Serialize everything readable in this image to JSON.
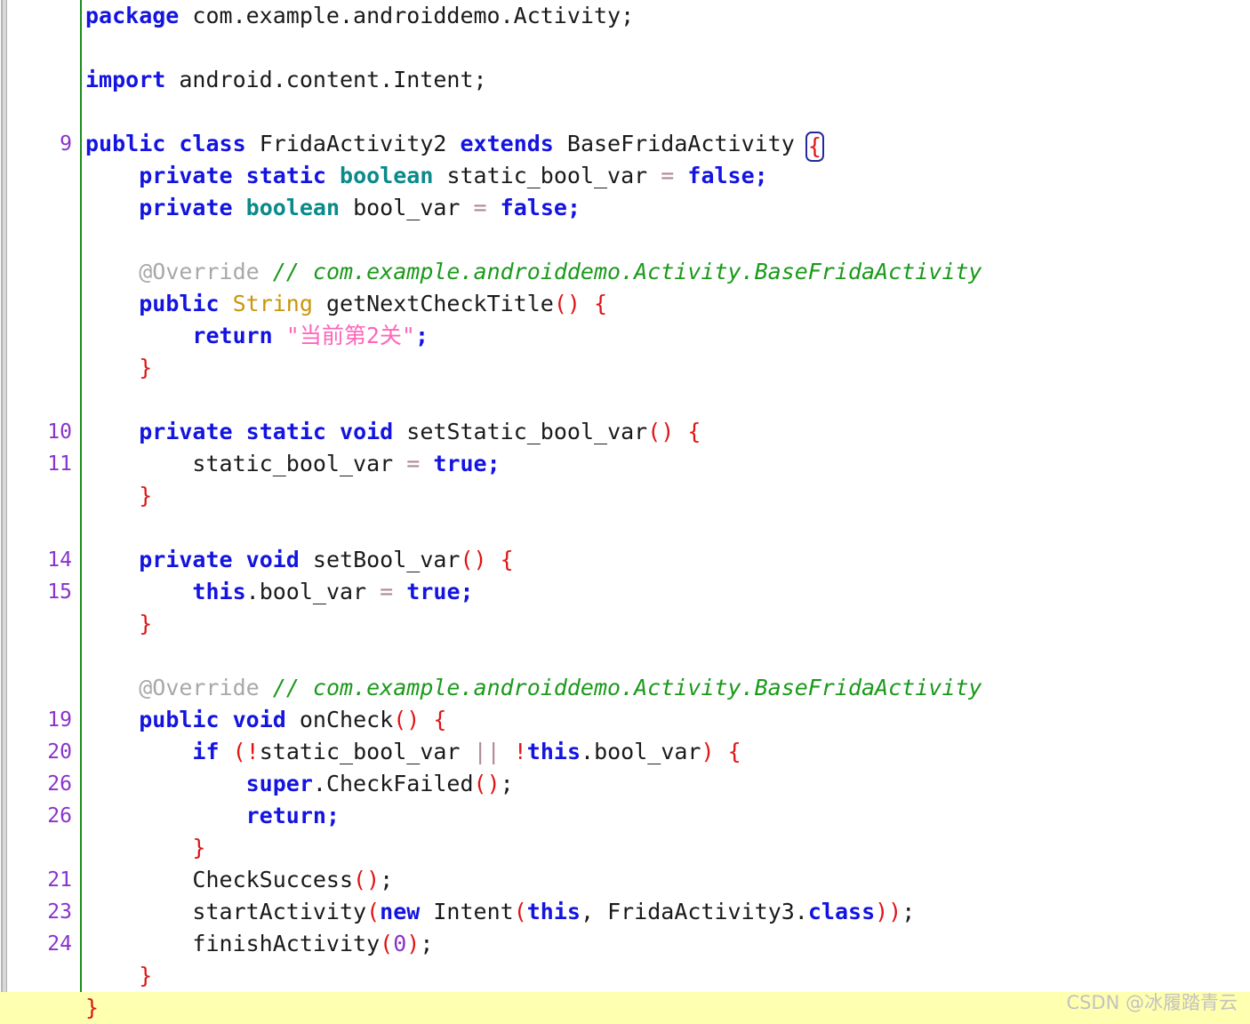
{
  "editor": {
    "language": "java",
    "background_color": "#ffffff",
    "gutter_rule_color": "#1a8c1a",
    "current_line_highlight_color": "#ffffb0",
    "line_number_color": "#8833cc"
  },
  "watermark": {
    "text": "CSDN @冰履踏青云"
  },
  "palette": {
    "keyword": "#1414e0",
    "type": "#0a8a8a",
    "class_type": "#c8960a",
    "identifier": "#1a1a1a",
    "punctuation": "#e01414",
    "number": "#8833cc",
    "string": "#ff66bb",
    "comment": "#1a9a1a",
    "annotation": "#a8a8a8",
    "operator": "#b08898",
    "bracket_match_outline": "#28289c"
  },
  "lines": [
    {
      "lineno": "",
      "current": false,
      "tokens": [
        {
          "t": "package",
          "c": "kw"
        },
        {
          "t": " ",
          "c": "plain"
        },
        {
          "t": "com.example.androiddemo.Activity",
          "c": "plain"
        },
        {
          "t": ";",
          "c": "plain"
        }
      ]
    },
    {
      "lineno": "",
      "current": false,
      "tokens": []
    },
    {
      "lineno": "",
      "current": false,
      "tokens": [
        {
          "t": "import",
          "c": "kw"
        },
        {
          "t": " ",
          "c": "plain"
        },
        {
          "t": "android.content.Intent",
          "c": "plain"
        },
        {
          "t": ";",
          "c": "plain"
        }
      ]
    },
    {
      "lineno": "",
      "current": false,
      "tokens": []
    },
    {
      "lineno": "9",
      "current": false,
      "tokens": [
        {
          "t": "public",
          "c": "kw"
        },
        {
          "t": " ",
          "c": "plain"
        },
        {
          "t": "class",
          "c": "kw"
        },
        {
          "t": " ",
          "c": "plain"
        },
        {
          "t": "FridaActivity2",
          "c": "plain"
        },
        {
          "t": " ",
          "c": "plain"
        },
        {
          "t": "extends",
          "c": "kw"
        },
        {
          "t": " ",
          "c": "plain"
        },
        {
          "t": "BaseFridaActivity",
          "c": "plain"
        },
        {
          "t": " ",
          "c": "plain"
        },
        {
          "t": "{",
          "c": "brace-match"
        }
      ]
    },
    {
      "lineno": "",
      "current": false,
      "tokens": [
        {
          "t": "    ",
          "c": "plain"
        },
        {
          "t": "private",
          "c": "kw"
        },
        {
          "t": " ",
          "c": "plain"
        },
        {
          "t": "static",
          "c": "kw"
        },
        {
          "t": " ",
          "c": "plain"
        },
        {
          "t": "boolean",
          "c": "type"
        },
        {
          "t": " ",
          "c": "plain"
        },
        {
          "t": "static_bool_var",
          "c": "plain"
        },
        {
          "t": " ",
          "c": "plain"
        },
        {
          "t": "=",
          "c": "op"
        },
        {
          "t": " ",
          "c": "plain"
        },
        {
          "t": "false",
          "c": "kw"
        },
        {
          "t": ";",
          "c": "semi"
        }
      ]
    },
    {
      "lineno": "",
      "current": false,
      "tokens": [
        {
          "t": "    ",
          "c": "plain"
        },
        {
          "t": "private",
          "c": "kw"
        },
        {
          "t": " ",
          "c": "plain"
        },
        {
          "t": "boolean",
          "c": "type"
        },
        {
          "t": " ",
          "c": "plain"
        },
        {
          "t": "bool_var",
          "c": "plain"
        },
        {
          "t": " ",
          "c": "plain"
        },
        {
          "t": "=",
          "c": "op"
        },
        {
          "t": " ",
          "c": "plain"
        },
        {
          "t": "false",
          "c": "kw"
        },
        {
          "t": ";",
          "c": "semi"
        }
      ]
    },
    {
      "lineno": "",
      "current": false,
      "tokens": []
    },
    {
      "lineno": "",
      "current": false,
      "tokens": [
        {
          "t": "    ",
          "c": "plain"
        },
        {
          "t": "@Override",
          "c": "anno"
        },
        {
          "t": " ",
          "c": "plain"
        },
        {
          "t": "// com.example.androiddemo.Activity.BaseFridaActivity",
          "c": "cmt"
        }
      ]
    },
    {
      "lineno": "",
      "current": false,
      "tokens": [
        {
          "t": "    ",
          "c": "plain"
        },
        {
          "t": "public",
          "c": "kw"
        },
        {
          "t": " ",
          "c": "plain"
        },
        {
          "t": "String",
          "c": "cls"
        },
        {
          "t": " ",
          "c": "plain"
        },
        {
          "t": "getNextCheckTitle",
          "c": "plain"
        },
        {
          "t": "()",
          "c": "punct"
        },
        {
          "t": " ",
          "c": "plain"
        },
        {
          "t": "{",
          "c": "punct"
        }
      ]
    },
    {
      "lineno": "",
      "current": false,
      "tokens": [
        {
          "t": "        ",
          "c": "plain"
        },
        {
          "t": "return",
          "c": "kw"
        },
        {
          "t": " ",
          "c": "plain"
        },
        {
          "t": "\"当前第2关\"",
          "c": "str"
        },
        {
          "t": ";",
          "c": "semi"
        }
      ]
    },
    {
      "lineno": "",
      "current": false,
      "tokens": [
        {
          "t": "    ",
          "c": "plain"
        },
        {
          "t": "}",
          "c": "punct"
        }
      ]
    },
    {
      "lineno": "",
      "current": false,
      "tokens": []
    },
    {
      "lineno": "10",
      "current": false,
      "tokens": [
        {
          "t": "    ",
          "c": "plain"
        },
        {
          "t": "private",
          "c": "kw"
        },
        {
          "t": " ",
          "c": "plain"
        },
        {
          "t": "static",
          "c": "kw"
        },
        {
          "t": " ",
          "c": "plain"
        },
        {
          "t": "void",
          "c": "kw"
        },
        {
          "t": " ",
          "c": "plain"
        },
        {
          "t": "setStatic_bool_var",
          "c": "plain"
        },
        {
          "t": "()",
          "c": "punct"
        },
        {
          "t": " ",
          "c": "plain"
        },
        {
          "t": "{",
          "c": "punct"
        }
      ]
    },
    {
      "lineno": "11",
      "current": false,
      "tokens": [
        {
          "t": "        ",
          "c": "plain"
        },
        {
          "t": "static_bool_var",
          "c": "plain"
        },
        {
          "t": " ",
          "c": "plain"
        },
        {
          "t": "=",
          "c": "op"
        },
        {
          "t": " ",
          "c": "plain"
        },
        {
          "t": "true",
          "c": "kw"
        },
        {
          "t": ";",
          "c": "semi"
        }
      ]
    },
    {
      "lineno": "",
      "current": false,
      "tokens": [
        {
          "t": "    ",
          "c": "plain"
        },
        {
          "t": "}",
          "c": "punct"
        }
      ]
    },
    {
      "lineno": "",
      "current": false,
      "tokens": []
    },
    {
      "lineno": "14",
      "current": false,
      "tokens": [
        {
          "t": "    ",
          "c": "plain"
        },
        {
          "t": "private",
          "c": "kw"
        },
        {
          "t": " ",
          "c": "plain"
        },
        {
          "t": "void",
          "c": "kw"
        },
        {
          "t": " ",
          "c": "plain"
        },
        {
          "t": "setBool_var",
          "c": "plain"
        },
        {
          "t": "()",
          "c": "punct"
        },
        {
          "t": " ",
          "c": "plain"
        },
        {
          "t": "{",
          "c": "punct"
        }
      ]
    },
    {
      "lineno": "15",
      "current": false,
      "tokens": [
        {
          "t": "        ",
          "c": "plain"
        },
        {
          "t": "this",
          "c": "kw"
        },
        {
          "t": ".bool_var",
          "c": "plain"
        },
        {
          "t": " ",
          "c": "plain"
        },
        {
          "t": "=",
          "c": "op"
        },
        {
          "t": " ",
          "c": "plain"
        },
        {
          "t": "true",
          "c": "kw"
        },
        {
          "t": ";",
          "c": "semi"
        }
      ]
    },
    {
      "lineno": "",
      "current": false,
      "tokens": [
        {
          "t": "    ",
          "c": "plain"
        },
        {
          "t": "}",
          "c": "punct"
        }
      ]
    },
    {
      "lineno": "",
      "current": false,
      "tokens": []
    },
    {
      "lineno": "",
      "current": false,
      "tokens": [
        {
          "t": "    ",
          "c": "plain"
        },
        {
          "t": "@Override",
          "c": "anno"
        },
        {
          "t": " ",
          "c": "plain"
        },
        {
          "t": "// com.example.androiddemo.Activity.BaseFridaActivity",
          "c": "cmt"
        }
      ]
    },
    {
      "lineno": "19",
      "current": false,
      "tokens": [
        {
          "t": "    ",
          "c": "plain"
        },
        {
          "t": "public",
          "c": "kw"
        },
        {
          "t": " ",
          "c": "plain"
        },
        {
          "t": "void",
          "c": "kw"
        },
        {
          "t": " ",
          "c": "plain"
        },
        {
          "t": "onCheck",
          "c": "plain"
        },
        {
          "t": "()",
          "c": "punct"
        },
        {
          "t": " ",
          "c": "plain"
        },
        {
          "t": "{",
          "c": "punct"
        }
      ]
    },
    {
      "lineno": "20",
      "current": false,
      "tokens": [
        {
          "t": "        ",
          "c": "plain"
        },
        {
          "t": "if",
          "c": "kw"
        },
        {
          "t": " ",
          "c": "plain"
        },
        {
          "t": "(",
          "c": "punct"
        },
        {
          "t": "!",
          "c": "punct"
        },
        {
          "t": "static_bool_var",
          "c": "plain"
        },
        {
          "t": " ",
          "c": "plain"
        },
        {
          "t": "||",
          "c": "op"
        },
        {
          "t": " ",
          "c": "plain"
        },
        {
          "t": "!",
          "c": "punct"
        },
        {
          "t": "this",
          "c": "kw"
        },
        {
          "t": ".bool_var",
          "c": "plain"
        },
        {
          "t": ")",
          "c": "punct"
        },
        {
          "t": " ",
          "c": "plain"
        },
        {
          "t": "{",
          "c": "punct"
        }
      ]
    },
    {
      "lineno": "26",
      "current": false,
      "tokens": [
        {
          "t": "            ",
          "c": "plain"
        },
        {
          "t": "super",
          "c": "kw"
        },
        {
          "t": ".CheckFailed",
          "c": "plain"
        },
        {
          "t": "()",
          "c": "punct"
        },
        {
          "t": ";",
          "c": "plain"
        }
      ]
    },
    {
      "lineno": "26",
      "current": false,
      "tokens": [
        {
          "t": "            ",
          "c": "plain"
        },
        {
          "t": "return",
          "c": "kw"
        },
        {
          "t": ";",
          "c": "semi"
        }
      ]
    },
    {
      "lineno": "",
      "current": false,
      "tokens": [
        {
          "t": "        ",
          "c": "plain"
        },
        {
          "t": "}",
          "c": "punct"
        }
      ]
    },
    {
      "lineno": "21",
      "current": false,
      "tokens": [
        {
          "t": "        ",
          "c": "plain"
        },
        {
          "t": "CheckSuccess",
          "c": "plain"
        },
        {
          "t": "()",
          "c": "punct"
        },
        {
          "t": ";",
          "c": "plain"
        }
      ]
    },
    {
      "lineno": "23",
      "current": false,
      "tokens": [
        {
          "t": "        ",
          "c": "plain"
        },
        {
          "t": "startActivity",
          "c": "plain"
        },
        {
          "t": "(",
          "c": "punct"
        },
        {
          "t": "new",
          "c": "kw"
        },
        {
          "t": " ",
          "c": "plain"
        },
        {
          "t": "Intent",
          "c": "plain"
        },
        {
          "t": "(",
          "c": "punct"
        },
        {
          "t": "this",
          "c": "kw"
        },
        {
          "t": ", ",
          "c": "plain"
        },
        {
          "t": "FridaActivity3.",
          "c": "plain"
        },
        {
          "t": "class",
          "c": "kw"
        },
        {
          "t": "))",
          "c": "punct"
        },
        {
          "t": ";",
          "c": "plain"
        }
      ]
    },
    {
      "lineno": "24",
      "current": false,
      "tokens": [
        {
          "t": "        ",
          "c": "plain"
        },
        {
          "t": "finishActivity",
          "c": "plain"
        },
        {
          "t": "(",
          "c": "punct"
        },
        {
          "t": "0",
          "c": "num"
        },
        {
          "t": ")",
          "c": "punct"
        },
        {
          "t": ";",
          "c": "plain"
        }
      ]
    },
    {
      "lineno": "",
      "current": false,
      "tokens": [
        {
          "t": "    ",
          "c": "plain"
        },
        {
          "t": "}",
          "c": "punct"
        }
      ]
    },
    {
      "lineno": "",
      "current": true,
      "tokens": [
        {
          "t": "}",
          "c": "punct"
        }
      ]
    }
  ]
}
